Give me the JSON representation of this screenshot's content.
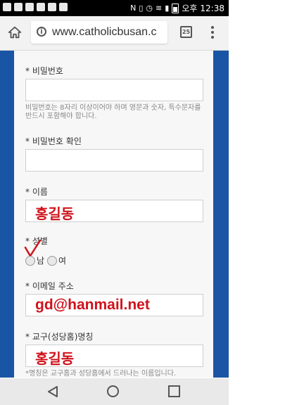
{
  "status_bar": {
    "time": "12:38",
    "ampm": "오후"
  },
  "browser": {
    "url": "www.catholicbusan.c",
    "tab_count": "25"
  },
  "form": {
    "password": {
      "label": "* 비밀번호",
      "value": "",
      "hint": "비밀번호는 8자리 이상이어야 하며 영문과 숫자, 특수문자를 반드시 포함해야 합니다."
    },
    "password_confirm": {
      "label": "* 비밀번호 확인",
      "value": ""
    },
    "name": {
      "label": "* 이름",
      "value": "홍길동"
    },
    "gender": {
      "label": "* 성별",
      "options": [
        "남",
        "여"
      ],
      "selected": "남"
    },
    "email": {
      "label": "* 이메일 주소",
      "value": "gd@hanmail.net"
    },
    "parish_nickname": {
      "label": "* 교구(성당홈)명칭",
      "value": "홍길동",
      "hint": "*명칭은 교구홈과 성당홈에서 드러나는 이름입니다."
    }
  },
  "colors": {
    "page_bg": "#1a55a5",
    "card_bg": "#f7f7f7",
    "handwriting": "#d0121b"
  }
}
